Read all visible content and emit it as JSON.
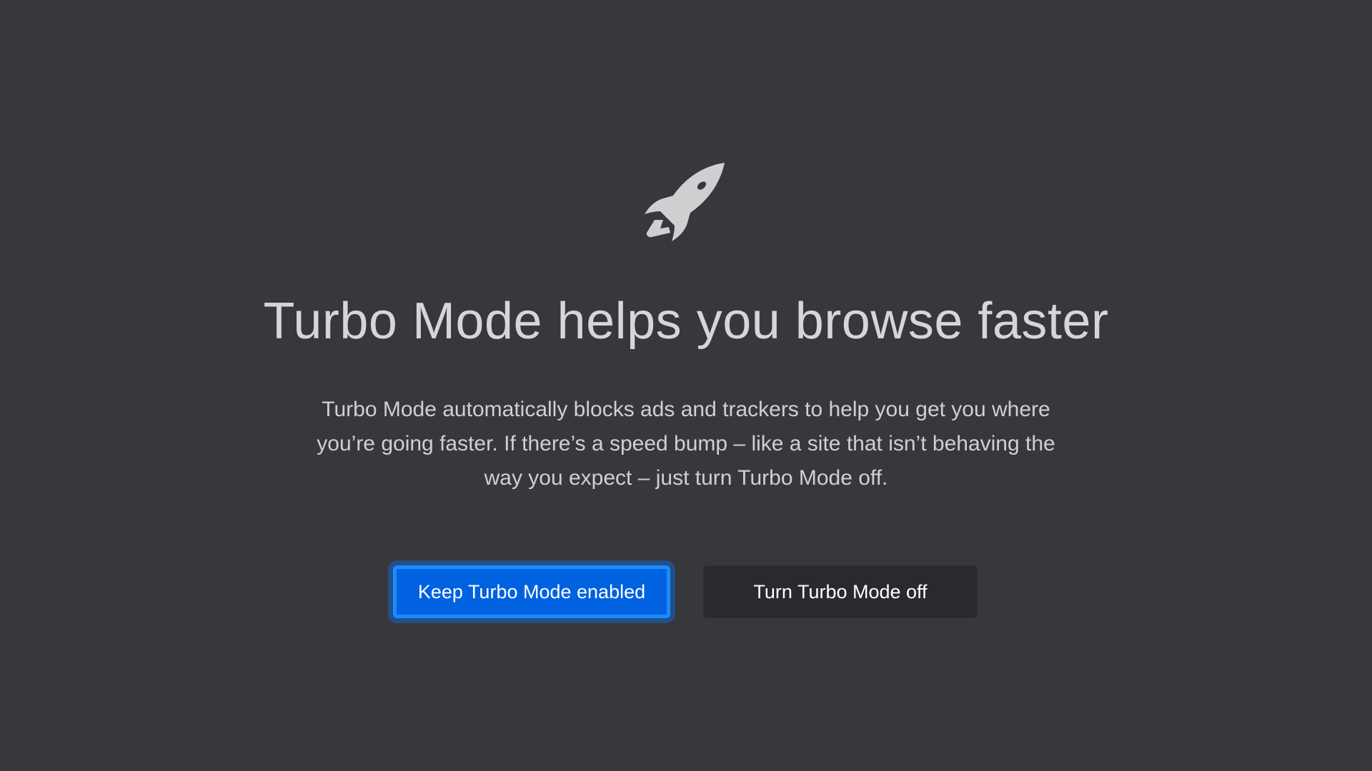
{
  "hero": {
    "icon": "rocket-icon",
    "title": "Turbo Mode helps you browse faster",
    "description": "Turbo Mode automatically blocks ads and trackers to help you get you where you’re going faster. If there’s a speed bump – like a site that isn’t behaving the way you expect – just turn Turbo Mode off."
  },
  "actions": {
    "keep_label": "Keep Turbo Mode enabled",
    "off_label": "Turn Turbo Mode off"
  },
  "colors": {
    "background": "#38373c",
    "primary_button": "#0062e0",
    "focus_ring": "#1a8cff",
    "secondary_button": "#2a292e",
    "icon": "#cfcfd2"
  }
}
